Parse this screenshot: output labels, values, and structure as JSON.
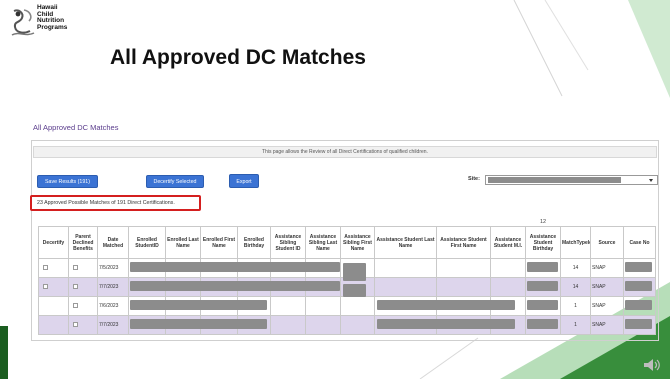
{
  "logo": {
    "lines": [
      "Hawaii",
      "Child",
      "Nutrition",
      "Programs"
    ]
  },
  "slide_title": "All Approved DC Matches",
  "page": {
    "heading": "All Approved DC Matches",
    "info": "This page allows the Review of all Direct Certifications of qualified children.",
    "buttons": {
      "save": "Save Results (191)",
      "decertify": "Decertify Selected",
      "export": "Export"
    },
    "site_label": "Site:",
    "summary": "23 Approved Possible Matches of 191 Direct Certifications."
  },
  "table": {
    "top_label": "12",
    "columns": [
      "Decertify",
      "Parent Declined Benefits",
      "Date Matched",
      "Enrolled StudentID",
      "Enrolled Last Name",
      "Enrolled First Name",
      "Enrolled Birthday",
      "Assistance Sibling Student ID",
      "Assistance Sibling Last Name",
      "Assistance Sibling First Name",
      "Assistance Student Last Name",
      "Assistance Student First Name",
      "Assistance Student M.I.",
      "Assistance Student Birthday",
      "MatchTypeId",
      "Source",
      "Case No"
    ],
    "rows": [
      {
        "date": "7/5/2023",
        "match_type": "14",
        "source": "SNAP"
      },
      {
        "date": "7/7/2023",
        "match_type": "14",
        "source": "SNAP"
      },
      {
        "date": "7/6/2023",
        "match_type": "1",
        "source": "SNAP"
      },
      {
        "date": "7/7/2023",
        "match_type": "1",
        "source": "SNAP"
      }
    ]
  },
  "colors": {
    "heading_purple": "#5a3c8c",
    "button_blue": "#3b73d4",
    "highlight_red": "#d41f1f",
    "row_alt": "#ddd5ec",
    "redaction_gray": "#8c8c8c",
    "accent_green": "#2e7d32",
    "light_green": "#a5d6a7"
  },
  "icons": [
    "logo-emblem",
    "chevron-down-icon",
    "speaker-icon"
  ]
}
